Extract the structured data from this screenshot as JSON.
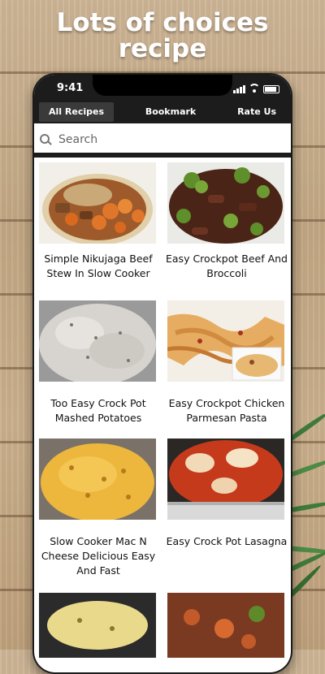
{
  "headline": {
    "line1": "Lots of choices",
    "line2": "recipe"
  },
  "status_bar": {
    "time": "9:41"
  },
  "tabs": [
    {
      "label": "All Recipes",
      "active": true
    },
    {
      "label": "Bookmark",
      "active": false
    },
    {
      "label": "Rate Us",
      "active": false
    }
  ],
  "search": {
    "placeholder": "Search",
    "value": ""
  },
  "recipes": [
    {
      "title": "Simple Nikujaga Beef Stew In Slow Cooker"
    },
    {
      "title": "Easy Crockpot Beef And Broccoli"
    },
    {
      "title": "Too Easy Crock Pot Mashed Potatoes"
    },
    {
      "title": "Easy Crockpot Chicken Parmesan Pasta"
    },
    {
      "title": "Slow Cooker Mac N Cheese Delicious Easy And Fast"
    },
    {
      "title": "Easy Crock Pot Lasagna"
    },
    {
      "title": ""
    },
    {
      "title": ""
    }
  ],
  "colors": {
    "app_bar": "#1c1c1c",
    "active_tab": "#3a3a3a",
    "background_wood": "#c6ab86"
  }
}
